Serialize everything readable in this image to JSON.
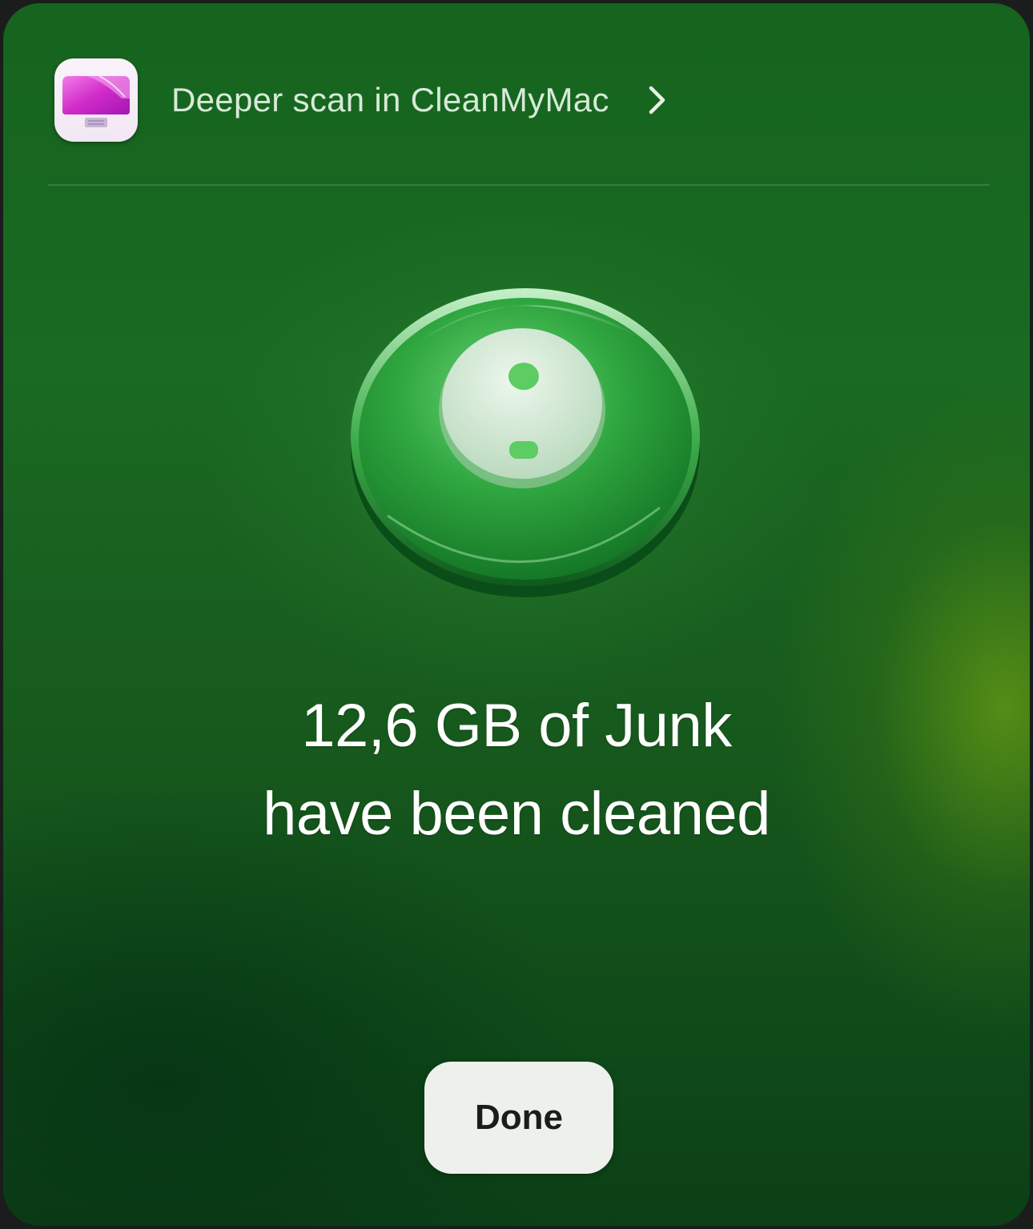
{
  "header": {
    "app_icon": "cleanmymac-app-icon",
    "link_label": "Deeper scan in CleanMyMac",
    "chevron_icon": "chevron-right-icon"
  },
  "illustration": {
    "icon": "green-disc-icon"
  },
  "result": {
    "line1": "12,6 GB of Junk",
    "line2": "have been cleaned"
  },
  "actions": {
    "done_label": "Done"
  },
  "colors": {
    "background_green": "#17591d",
    "accent_lime": "#5f9614",
    "app_icon_magenta": "#d12bc9",
    "button_bg": "#eef0ec"
  }
}
